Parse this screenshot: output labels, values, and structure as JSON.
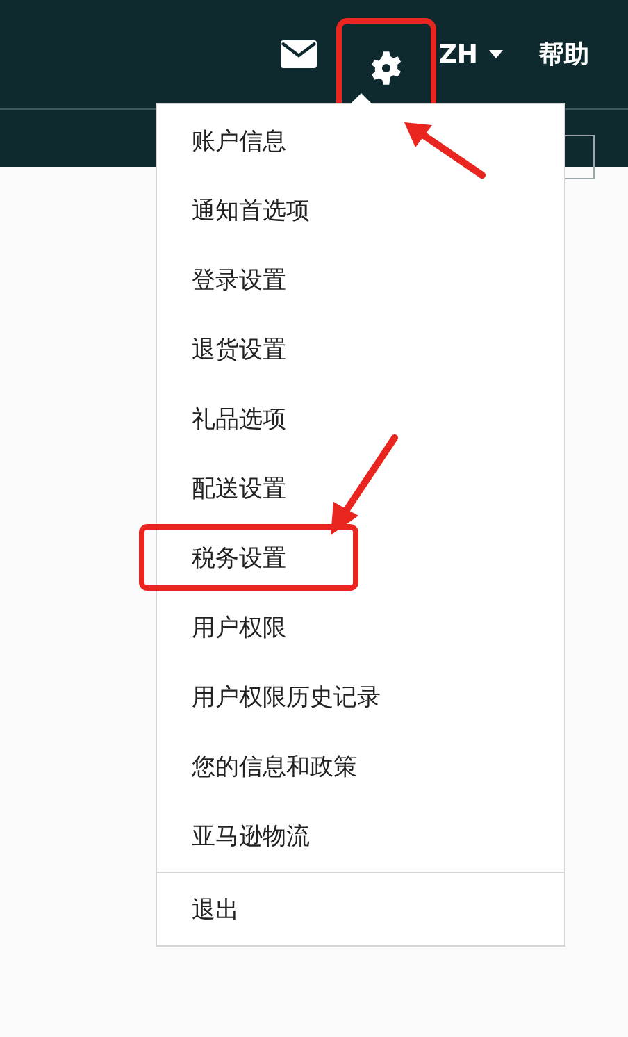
{
  "top_bar": {
    "settings_highlighted": true,
    "language": "ZH",
    "help": "帮助"
  },
  "settings_menu": {
    "items": [
      {
        "label": "账户信息",
        "highlighted": false
      },
      {
        "label": "通知首选项",
        "highlighted": false
      },
      {
        "label": "登录设置",
        "highlighted": false
      },
      {
        "label": "退货设置",
        "highlighted": false
      },
      {
        "label": "礼品选项",
        "highlighted": false
      },
      {
        "label": "配送设置",
        "highlighted": false
      },
      {
        "label": "税务设置",
        "highlighted": true
      },
      {
        "label": "用户权限",
        "highlighted": false
      },
      {
        "label": "用户权限历史记录",
        "highlighted": false
      },
      {
        "label": "您的信息和政策",
        "highlighted": false
      },
      {
        "label": "亚马逊物流",
        "highlighted": false
      }
    ],
    "footer_items": [
      {
        "label": "退出",
        "highlighted": false
      }
    ]
  }
}
